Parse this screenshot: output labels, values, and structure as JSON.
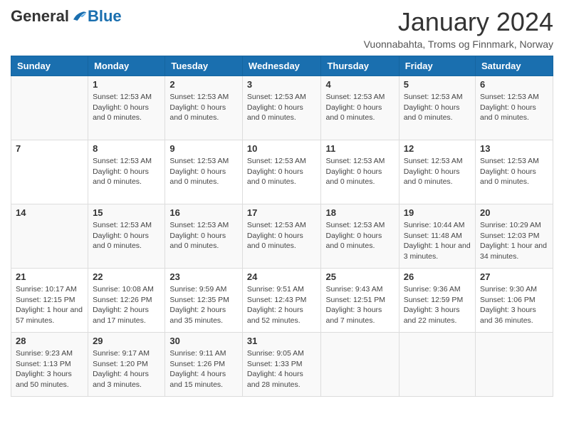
{
  "header": {
    "logo": {
      "general": "General",
      "blue": "Blue"
    },
    "title": "January 2024",
    "location": "Vuonnabahta, Troms og Finnmark, Norway"
  },
  "weekdays": [
    "Sunday",
    "Monday",
    "Tuesday",
    "Wednesday",
    "Thursday",
    "Friday",
    "Saturday"
  ],
  "weeks": [
    [
      {
        "day": "",
        "info": ""
      },
      {
        "day": "1",
        "info": "Sunset: 12:53 AM\nDaylight: 0 hours and 0 minutes."
      },
      {
        "day": "2",
        "info": "Sunset: 12:53 AM\nDaylight: 0 hours and 0 minutes."
      },
      {
        "day": "3",
        "info": "Sunset: 12:53 AM\nDaylight: 0 hours and 0 minutes."
      },
      {
        "day": "4",
        "info": "Sunset: 12:53 AM\nDaylight: 0 hours and 0 minutes."
      },
      {
        "day": "5",
        "info": "Sunset: 12:53 AM\nDaylight: 0 hours and 0 minutes."
      },
      {
        "day": "6",
        "info": "Sunset: 12:53 AM\nDaylight: 0 hours and 0 minutes."
      }
    ],
    [
      {
        "day": "7",
        "info": ""
      },
      {
        "day": "8",
        "info": "Sunset: 12:53 AM\nDaylight: 0 hours and 0 minutes."
      },
      {
        "day": "9",
        "info": "Sunset: 12:53 AM\nDaylight: 0 hours and 0 minutes."
      },
      {
        "day": "10",
        "info": "Sunset: 12:53 AM\nDaylight: 0 hours and 0 minutes."
      },
      {
        "day": "11",
        "info": "Sunset: 12:53 AM\nDaylight: 0 hours and 0 minutes."
      },
      {
        "day": "12",
        "info": "Sunset: 12:53 AM\nDaylight: 0 hours and 0 minutes."
      },
      {
        "day": "13",
        "info": "Sunset: 12:53 AM\nDaylight: 0 hours and 0 minutes."
      }
    ],
    [
      {
        "day": "14",
        "info": ""
      },
      {
        "day": "15",
        "info": "Sunset: 12:53 AM\nDaylight: 0 hours and 0 minutes."
      },
      {
        "day": "16",
        "info": "Sunset: 12:53 AM\nDaylight: 0 hours and 0 minutes."
      },
      {
        "day": "17",
        "info": "Sunset: 12:53 AM\nDaylight: 0 hours and 0 minutes."
      },
      {
        "day": "18",
        "info": "Sunset: 12:53 AM\nDaylight: 0 hours and 0 minutes."
      },
      {
        "day": "19",
        "info": "Sunrise: 10:44 AM\nSunset: 11:48 AM\nDaylight: 1 hour and 3 minutes."
      },
      {
        "day": "20",
        "info": "Sunrise: 10:29 AM\nSunset: 12:03 PM\nDaylight: 1 hour and 34 minutes."
      }
    ],
    [
      {
        "day": "21",
        "info": "Sunrise: 10:17 AM\nSunset: 12:15 PM\nDaylight: 1 hour and 57 minutes."
      },
      {
        "day": "22",
        "info": "Sunrise: 10:08 AM\nSunset: 12:26 PM\nDaylight: 2 hours and 17 minutes."
      },
      {
        "day": "23",
        "info": "Sunrise: 9:59 AM\nSunset: 12:35 PM\nDaylight: 2 hours and 35 minutes."
      },
      {
        "day": "24",
        "info": "Sunrise: 9:51 AM\nSunset: 12:43 PM\nDaylight: 2 hours and 52 minutes."
      },
      {
        "day": "25",
        "info": "Sunrise: 9:43 AM\nSunset: 12:51 PM\nDaylight: 3 hours and 7 minutes."
      },
      {
        "day": "26",
        "info": "Sunrise: 9:36 AM\nSunset: 12:59 PM\nDaylight: 3 hours and 22 minutes."
      },
      {
        "day": "27",
        "info": "Sunrise: 9:30 AM\nSunset: 1:06 PM\nDaylight: 3 hours and 36 minutes."
      }
    ],
    [
      {
        "day": "28",
        "info": "Sunrise: 9:23 AM\nSunset: 1:13 PM\nDaylight: 3 hours and 50 minutes."
      },
      {
        "day": "29",
        "info": "Sunrise: 9:17 AM\nSunset: 1:20 PM\nDaylight: 4 hours and 3 minutes."
      },
      {
        "day": "30",
        "info": "Sunrise: 9:11 AM\nSunset: 1:26 PM\nDaylight: 4 hours and 15 minutes."
      },
      {
        "day": "31",
        "info": "Sunrise: 9:05 AM\nSunset: 1:33 PM\nDaylight: 4 hours and 28 minutes."
      },
      {
        "day": "",
        "info": ""
      },
      {
        "day": "",
        "info": ""
      },
      {
        "day": "",
        "info": ""
      }
    ]
  ]
}
